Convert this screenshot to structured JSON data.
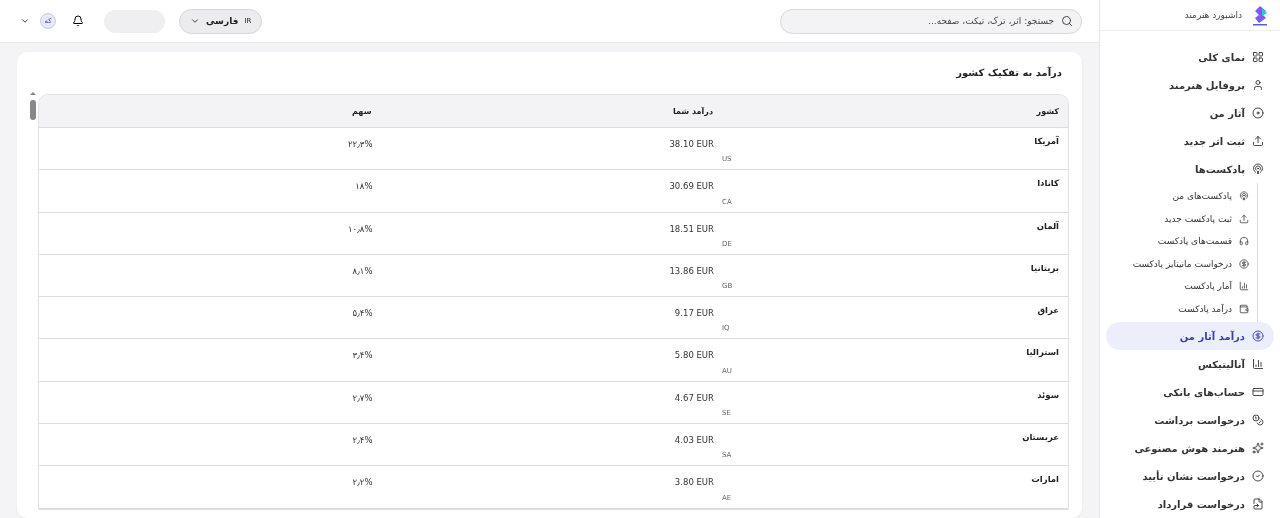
{
  "sidebar": {
    "title": "داشبورد هنرمند",
    "items": [
      {
        "label": "نمای کلی",
        "selected": false
      },
      {
        "label": "پروفایل هنرمند",
        "selected": false
      },
      {
        "label": "آثار من",
        "selected": false
      },
      {
        "label": "ثبت اثر جدید",
        "selected": false
      },
      {
        "label": "پادکست‌ها",
        "selected": false,
        "expanded": true,
        "children": [
          {
            "label": "پادکست‌های من",
            "selected": false
          },
          {
            "label": "ثبت پادکست جدید",
            "selected": false
          },
          {
            "label": "قسمت‌های پادکست",
            "selected": false
          },
          {
            "label": "درخواست مانیتایز پادکست",
            "selected": false
          },
          {
            "label": "آمار پادکست",
            "selected": false
          },
          {
            "label": "درآمد پادکست",
            "selected": false
          }
        ]
      },
      {
        "label": "درآمد آثار من",
        "selected": true
      },
      {
        "label": "آنالیتیکس",
        "selected": false
      },
      {
        "label": "حساب‌های بانکی",
        "selected": false
      },
      {
        "label": "درخواست برداشت",
        "selected": false
      },
      {
        "label": "هنرمند هوش مصنوعی",
        "selected": false
      },
      {
        "label": "درخواست نشان تأیید",
        "selected": false
      },
      {
        "label": "درخواست قرارداد",
        "selected": false
      }
    ]
  },
  "topbar": {
    "search": {
      "placeholder": "جستجو: اثر، ترک، تیکت، صفحه..."
    },
    "language": {
      "code": "IR",
      "label": "فارسی"
    },
    "avatar": "که"
  },
  "card": {
    "title": "درآمد به تفکیک کشور",
    "table": {
      "columns": [
        "کشور",
        "درآمد شما",
        "سهم"
      ],
      "rows": [
        {
          "country": "آمریکا",
          "code": "US",
          "income": "38.10 EUR",
          "share": "۲۲٫۳%"
        },
        {
          "country": "کانادا",
          "code": "CA",
          "income": "30.69 EUR",
          "share": "۱۸%"
        },
        {
          "country": "آلمان",
          "code": "DE",
          "income": "18.51 EUR",
          "share": "۱۰٫۸%"
        },
        {
          "country": "بریتانیا",
          "code": "GB",
          "income": "13.86 EUR",
          "share": "۸٫۱%"
        },
        {
          "country": "عراق",
          "code": "IQ",
          "income": "9.17 EUR",
          "share": "۵٫۴%"
        },
        {
          "country": "استرالیا",
          "code": "AU",
          "income": "5.80 EUR",
          "share": "۳٫۴%"
        },
        {
          "country": "سوئد",
          "code": "SE",
          "income": "4.67 EUR",
          "share": "۲٫۷%"
        },
        {
          "country": "عربستان",
          "code": "SA",
          "income": "4.03 EUR",
          "share": "۲٫۴%"
        },
        {
          "country": "امارات",
          "code": "AE",
          "income": "3.80 EUR",
          "share": "۲٫۲%"
        }
      ]
    }
  }
}
